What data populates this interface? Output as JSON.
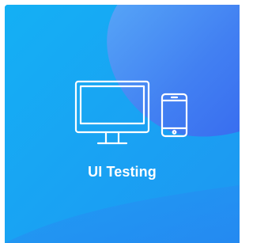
{
  "card": {
    "title": "UI Testing",
    "icon": "monitor-and-smartphone-icon",
    "colors": {
      "background": "#19a8f2",
      "accent_blob": "#3d7ff0",
      "top_glow": "#c26af0",
      "text": "#ffffff"
    }
  }
}
